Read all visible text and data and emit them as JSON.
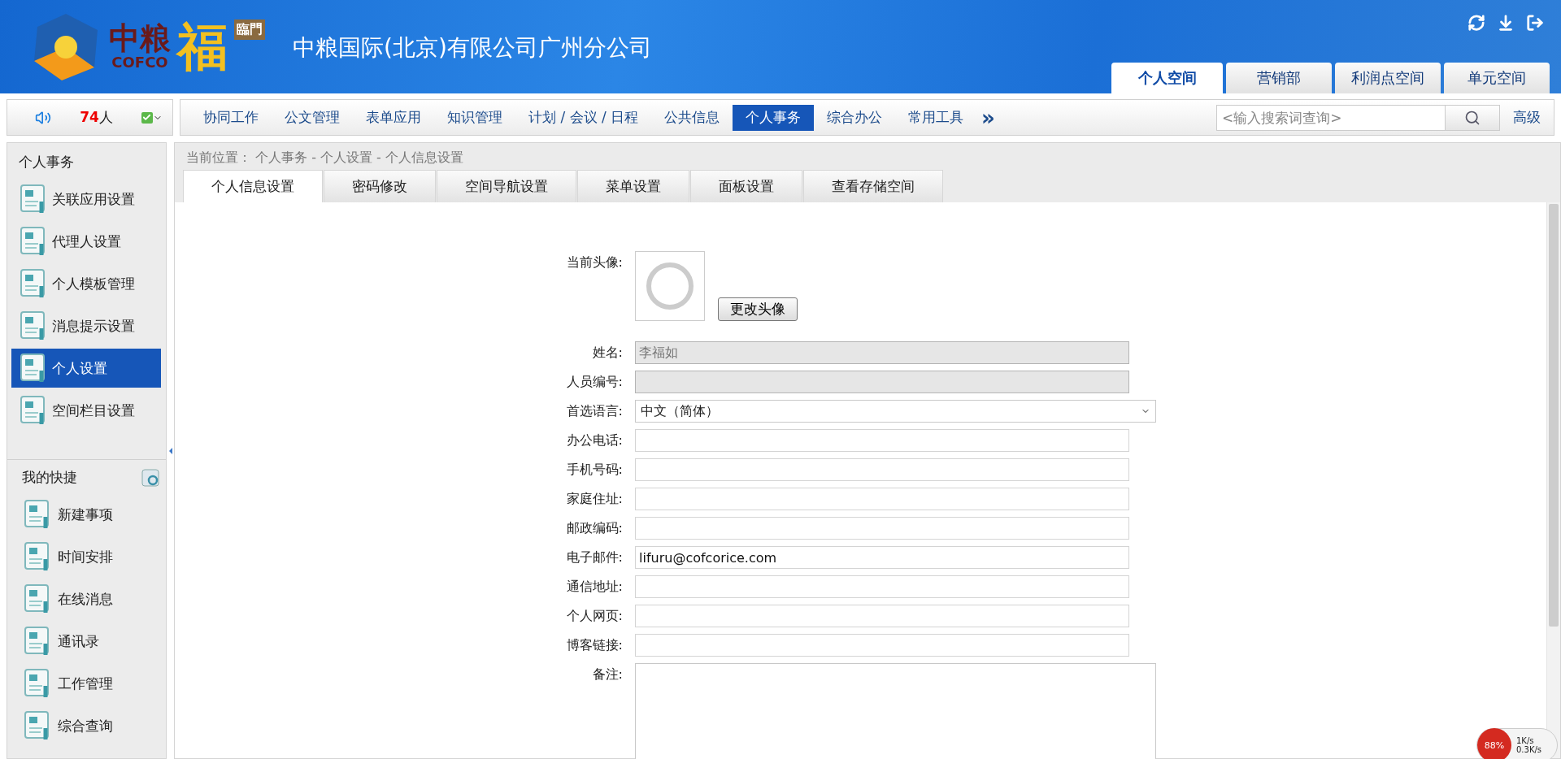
{
  "header": {
    "logo": {
      "cn": "中粮",
      "en": "COFCO",
      "fu": "福",
      "linmen": "臨門"
    },
    "title": "中粮国际(北京)有限公司广州分公司",
    "space_tabs": [
      {
        "label": "个人空间",
        "selected": true
      },
      {
        "label": "营销部",
        "selected": false
      },
      {
        "label": "利润点空间",
        "selected": false
      },
      {
        "label": "单元空间",
        "selected": false
      }
    ]
  },
  "online": {
    "count": "74",
    "unit": "人"
  },
  "menu": [
    {
      "label": "协同工作",
      "selected": false
    },
    {
      "label": "公文管理",
      "selected": false
    },
    {
      "label": "表单应用",
      "selected": false
    },
    {
      "label": "知识管理",
      "selected": false
    },
    {
      "label": "计划 / 会议 / 日程",
      "selected": false
    },
    {
      "label": "公共信息",
      "selected": false
    },
    {
      "label": "个人事务",
      "selected": true
    },
    {
      "label": "综合办公",
      "selected": false
    },
    {
      "label": "常用工具",
      "selected": false
    }
  ],
  "menu_more": "»",
  "search": {
    "placeholder": "<输入搜索词查询>",
    "advanced": "高级"
  },
  "sidebar": {
    "title": "个人事务",
    "items": [
      {
        "label": "关联应用设置",
        "selected": false
      },
      {
        "label": "代理人设置",
        "selected": false
      },
      {
        "label": "个人模板管理",
        "selected": false
      },
      {
        "label": "消息提示设置",
        "selected": false
      },
      {
        "label": "个人设置",
        "selected": true
      },
      {
        "label": "空间栏目设置",
        "selected": false
      }
    ],
    "shortcuts_title": "我的快捷",
    "shortcuts": [
      "新建事项",
      "时间安排",
      "在线消息",
      "通讯录",
      "工作管理",
      "综合查询"
    ]
  },
  "breadcrumb": "当前位置： 个人事务 - 个人设置 - 个人信息设置",
  "tabs": [
    {
      "label": "个人信息设置",
      "selected": true
    },
    {
      "label": "密码修改",
      "selected": false
    },
    {
      "label": "空间导航设置",
      "selected": false
    },
    {
      "label": "菜单设置",
      "selected": false
    },
    {
      "label": "面板设置",
      "selected": false
    },
    {
      "label": "查看存储空间",
      "selected": false
    }
  ],
  "form": {
    "avatar_label": "当前头像:",
    "change_avatar": "更改头像",
    "fields": [
      {
        "label": "姓名:",
        "kind": "text",
        "value": "李福如",
        "disabled": true
      },
      {
        "label": "人员编号:",
        "kind": "text",
        "disabled": true
      },
      {
        "label": "首选语言:",
        "kind": "select",
        "value": "中文（简体）"
      },
      {
        "label": "办公电话:",
        "kind": "text",
        "disabled": false
      },
      {
        "label": "手机号码:",
        "kind": "text",
        "disabled": false
      },
      {
        "label": "家庭住址:",
        "kind": "text",
        "disabled": false
      },
      {
        "label": "邮政编码:",
        "kind": "text",
        "disabled": false
      },
      {
        "label": "电子邮件:",
        "kind": "text",
        "value": "lifuru@cofcorice.com",
        "disabled": false
      },
      {
        "label": "通信地址:",
        "kind": "text",
        "disabled": false
      },
      {
        "label": "个人网页:",
        "kind": "text",
        "disabled": false
      },
      {
        "label": "博客链接:",
        "kind": "text",
        "disabled": false
      },
      {
        "label": "备注:",
        "kind": "textarea"
      }
    ]
  },
  "speed_meter": {
    "percent": "88%",
    "up": "1K/s",
    "down": "0.3K/s"
  }
}
